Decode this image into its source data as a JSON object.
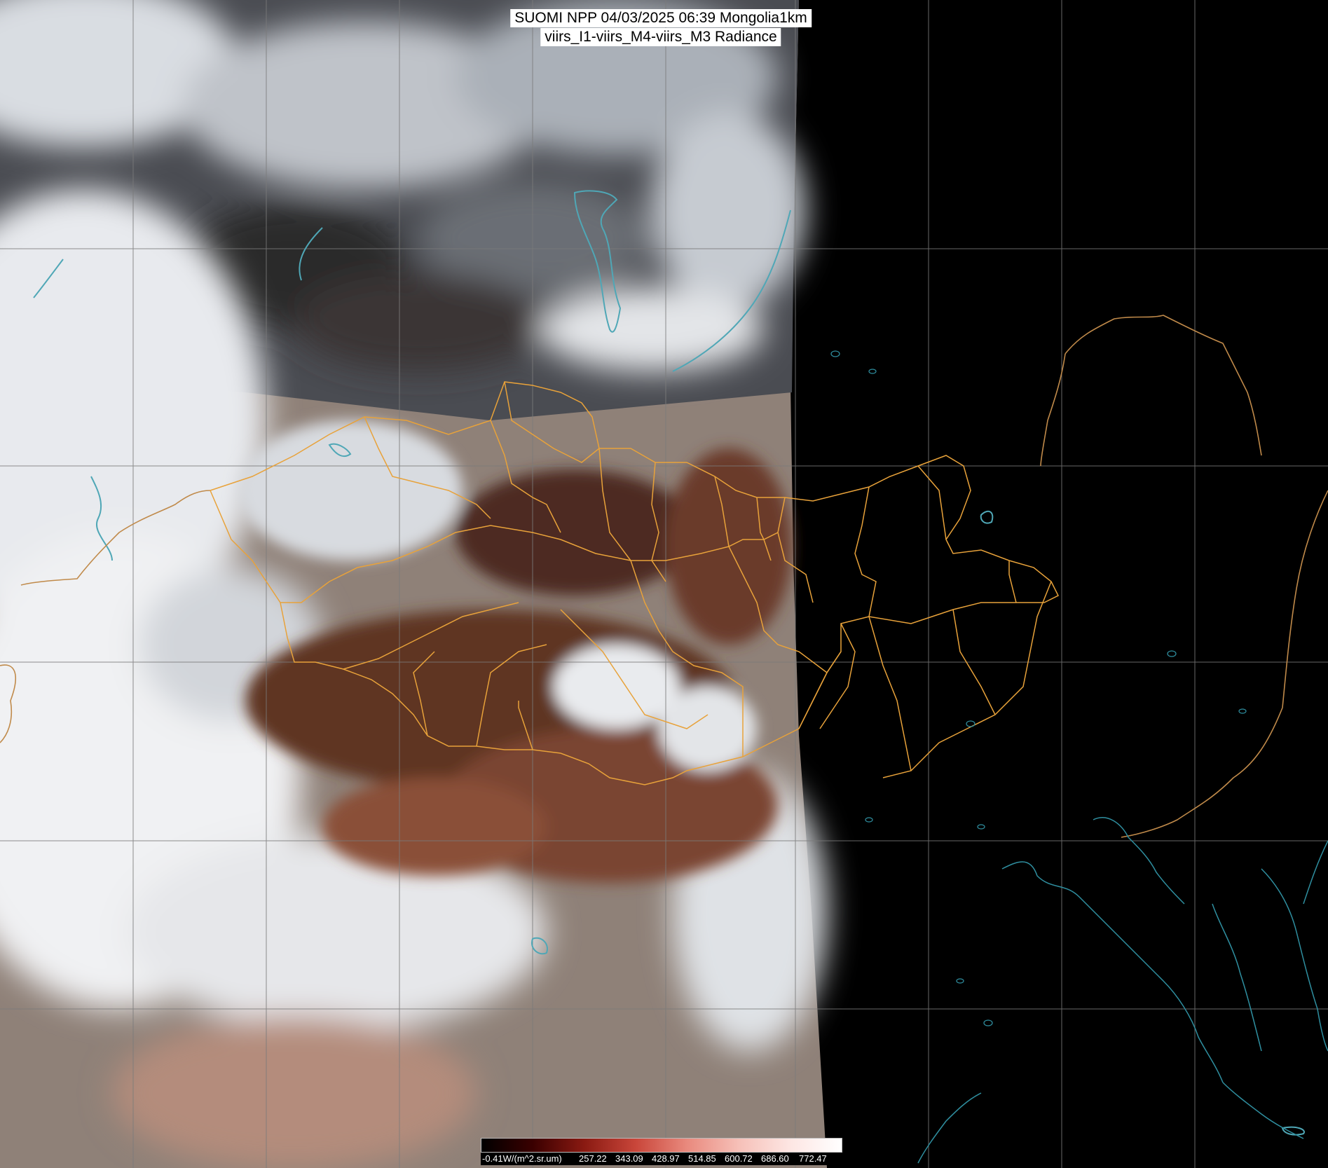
{
  "title": {
    "line1": "SUOMI NPP 04/03/2025 06:39 Mongolia1km",
    "line2": "viirs_I1-viirs_M4-viirs_M3 Radiance"
  },
  "map": {
    "type": "satellite true-color composite",
    "swath": "daytime swath left, night (no data) right",
    "overlays": [
      "latitude/longitude graticule",
      "national borders",
      "province borders",
      "coastlines and lakes"
    ]
  },
  "colorbar": {
    "labels": [
      "-0.41W/(m^2.sr.um)",
      "257.22",
      "343.09",
      "428.97",
      "514.85",
      "600.72",
      "686.60",
      "772.47"
    ],
    "colors": [
      "#000000",
      "#3a0000",
      "#8a1a12",
      "#c9463a",
      "#e98a7e",
      "#f6c0b8",
      "#fde6e3",
      "#ffffff"
    ]
  },
  "colors": {
    "background": "#000000",
    "graticule": "#7a7a7a",
    "province_border": "#e8a23a",
    "country_border": "#c08a4a",
    "coastline": "#2f8fa0",
    "lake": "#4fa7b6"
  }
}
